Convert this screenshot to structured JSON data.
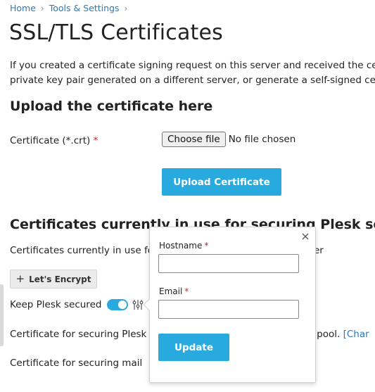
{
  "breadcrumb": {
    "items": [
      "Home",
      "Tools & Settings"
    ]
  },
  "page": {
    "title": "SSL/TLS Certificates"
  },
  "intro": {
    "line1": "If you created a certificate signing request on this server and received the certific",
    "line2": "private key pair generated on a different server, or generate a self-signed certific"
  },
  "upload": {
    "section_title": "Upload the certificate here",
    "field_label": "Certificate (*.crt)",
    "required_mark": "*",
    "choose_file_label": "Choose file",
    "file_status": "No file chosen",
    "upload_button": "Upload Certificate"
  },
  "current": {
    "section_title": "Certificates currently in use for securing Plesk server",
    "description": "Certificates currently in use for",
    "description_tail": "er",
    "lets_encrypt_button": "Let's Encrypt",
    "keep_secured_label": "Keep Plesk secured",
    "keep_secured_on": true,
    "row_plesk": "Certificate for securing Plesk",
    "row_plesk_tail": "er pool.",
    "row_plesk_link": "[Char",
    "row_mail": "Certificate for securing mail"
  },
  "popover": {
    "hostname_label": "Hostname",
    "hostname_value": "",
    "email_label": "Email",
    "email_value": "",
    "required_mark": "*",
    "update_button": "Update"
  },
  "colors": {
    "accent": "#28aade",
    "link": "#2b79b8",
    "required": "#d02020"
  }
}
